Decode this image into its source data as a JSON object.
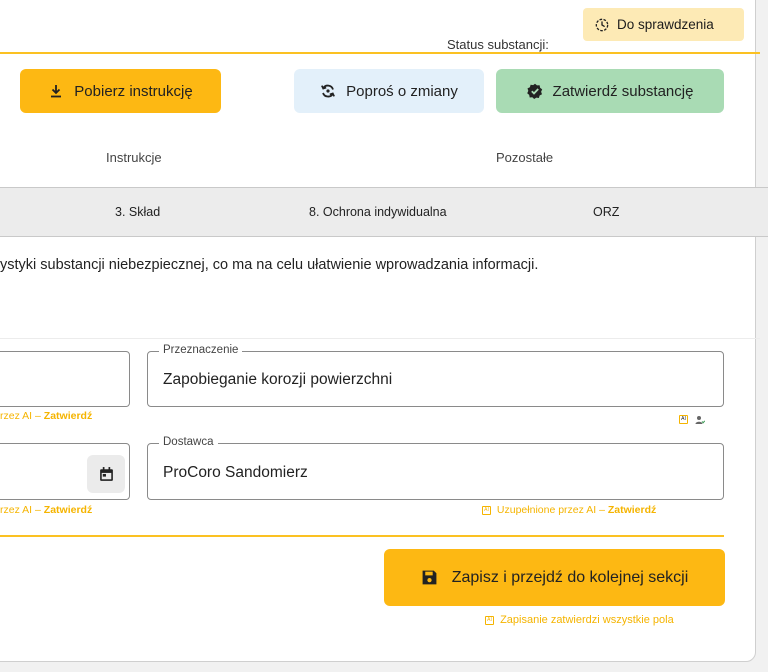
{
  "status": {
    "label": "Status substancji:",
    "value": "Do sprawdzenia"
  },
  "actions": {
    "download": "Pobierz instrukcję",
    "request_changes": "Poproś o zmiany",
    "approve": "Zatwierdź substancję"
  },
  "groups": {
    "instructions": "Instrukcje",
    "other": "Pozostałe"
  },
  "tabs": [
    "3. Skład",
    "8. Ochrona indywidualna",
    "ORZ"
  ],
  "description": "ystyki substancji niebezpiecznej, co ma na celu ułatwienie wprowadzania informacji.",
  "fields": {
    "purpose": {
      "label": "Przeznaczenie",
      "value": "Zapobieganie korozji powierzchni"
    },
    "supplier": {
      "label": "Dostawca",
      "value": "ProCoro Sandomierz"
    }
  },
  "ai": {
    "badge": "AI",
    "partial_filled": "rzez AI –",
    "filled": "Uzupełnione przez AI –",
    "confirm": "Zatwierdź"
  },
  "save": {
    "label": "Zapisz i przejdź do kolejnej sekcji",
    "note": "Zapisanie zatwierdzi wszystkie pola"
  },
  "colors": {
    "accent": "#fdb813",
    "approve": "#a9dbb4",
    "request": "#e3f0fa",
    "status_bg": "#fdeab5"
  }
}
